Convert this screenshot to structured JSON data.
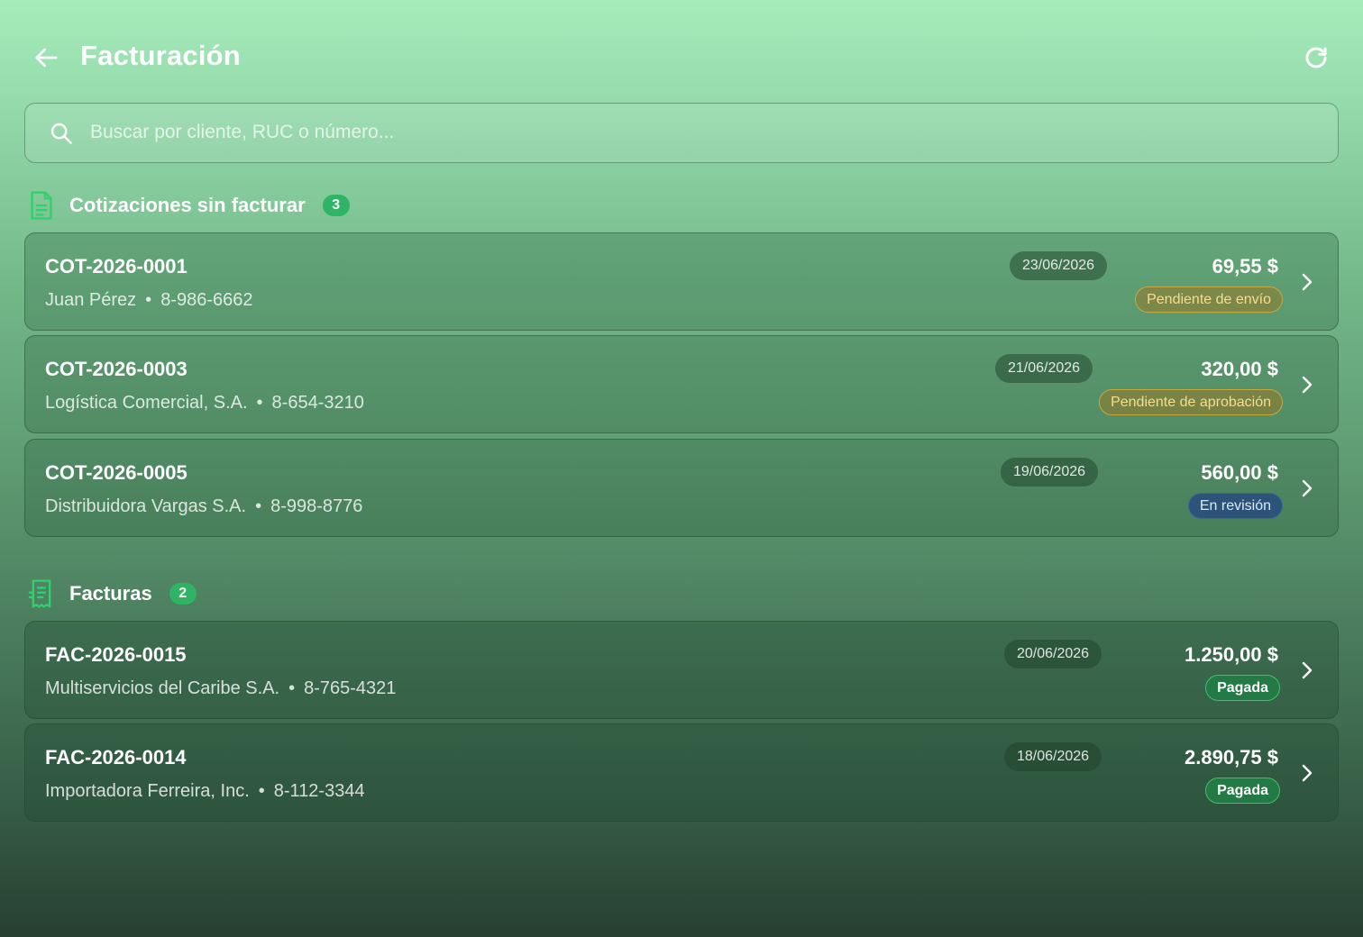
{
  "header": {
    "title": "Facturación",
    "back_icon": "arrow-left-icon",
    "refresh_icon": "refresh-icon"
  },
  "search": {
    "placeholder": "Buscar por cliente, RUC o número...",
    "value": ""
  },
  "quotes": {
    "title": "Cotizaciones sin facturar",
    "count": "3",
    "icon": "document-icon",
    "items": [
      {
        "number": "COT-2026-0001",
        "client": "Juan Pérez",
        "ruc": "8-986-6662",
        "date": "23/06/2026",
        "amount": "69,55 $",
        "status": "Pendiente de envío"
      },
      {
        "number": "COT-2026-0003",
        "client": "Logística Comercial, S.A.",
        "ruc": "8-654-3210",
        "date": "21/06/2026",
        "amount": "320,00 $",
        "status": "Pendiente de aprobación"
      },
      {
        "number": "COT-2026-0005",
        "client": "Distribuidora Vargas S.A.",
        "ruc": "8-998-8776",
        "date": "19/06/2026",
        "amount": "560,00 $",
        "status": "En revisión"
      }
    ]
  },
  "invoices": {
    "title": "Facturas",
    "count": "2",
    "icon": "invoice-icon",
    "items": [
      {
        "number": "FAC-2026-0015",
        "client": "Multiservicios del Caribe S.A.",
        "ruc": "8-765-4321",
        "date": "20/06/2026",
        "amount": "1.250,00 $",
        "status": "Pagada"
      },
      {
        "number": "FAC-2026-0014",
        "client": "Importadora Ferreira, Inc.",
        "ruc": "8-112-3344",
        "date": "18/06/2026",
        "amount": "2.890,75 $",
        "status": "Pagada"
      }
    ]
  },
  "separator": "•",
  "colors": {
    "accent_green": "#2fb466",
    "pending_yellow": "#c9a83e",
    "review_blue": "#2d5478",
    "paid_green": "#247a45"
  }
}
